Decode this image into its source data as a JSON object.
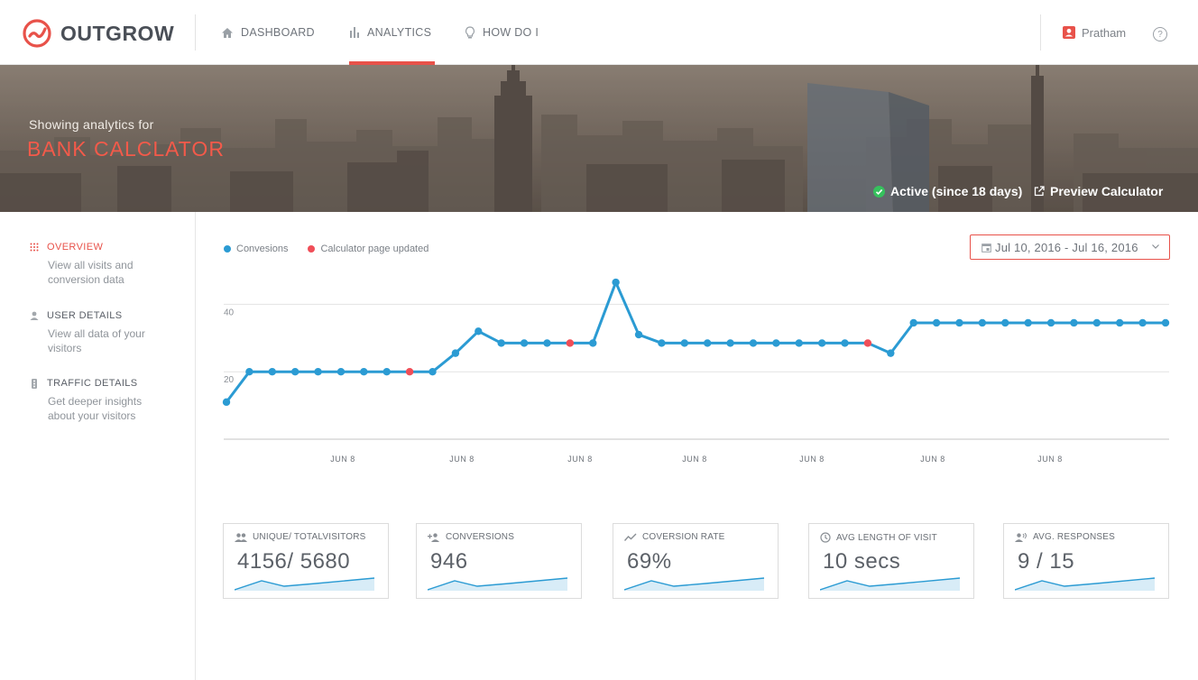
{
  "app": {
    "brand": "OUTGROW",
    "accent_color": "#e8524a",
    "line_color": "#2b9bd3"
  },
  "nav": {
    "items": [
      {
        "label": "DASHBOARD",
        "icon": "home-icon"
      },
      {
        "label": "ANALYTICS",
        "icon": "bar-chart-icon",
        "active": true
      },
      {
        "label": "HOW DO I",
        "icon": "lightbulb-icon"
      }
    ],
    "user_name": "Pratham",
    "help_glyph": "?"
  },
  "hero": {
    "subtitle": "Showing analytics for",
    "title": "BANK CALCLATOR",
    "status": "Active (since 18 days)",
    "preview_label": "Preview Calculator"
  },
  "sidebar": {
    "items": [
      {
        "title": "OVERVIEW",
        "desc_line1": "View all visits and",
        "desc_line2": "conversion data",
        "icon": "grid-dots-icon",
        "active": true
      },
      {
        "title": "USER DETAILS",
        "desc_line1": "View all data of your",
        "desc_line2": "visitors",
        "icon": "person-icon"
      },
      {
        "title": "TRAFFIC DETAILS",
        "desc_line1": "Get deeper insights",
        "desc_line2": "about your visitors",
        "icon": "traffic-light-icon"
      }
    ]
  },
  "filters": {
    "date_range": "Jul 10, 2016 - Jul 16, 2016"
  },
  "chart_data": {
    "type": "line",
    "legend": [
      {
        "name": "Convesions",
        "color": "#2b9bd3"
      },
      {
        "name": "Calculator page updated",
        "color": "#f04e58"
      }
    ],
    "ylim": [
      0,
      50
    ],
    "yticks": [
      20,
      40
    ],
    "xtick_labels": [
      "JUN 8",
      "JUN 8",
      "JUN 8",
      "JUN 8",
      "JUN 8",
      "JUN 8",
      "JUN 8"
    ],
    "grid": true,
    "series": [
      {
        "name": "Convesions",
        "values": [
          11,
          20,
          20,
          20,
          20,
          20,
          20,
          20,
          20,
          20,
          25.5,
          32,
          28.5,
          28.5,
          28.5,
          28.5,
          28.5,
          46.5,
          31,
          28.5,
          28.5,
          28.5,
          28.5,
          28.5,
          28.5,
          28.5,
          28.5,
          28.5,
          28.5,
          25.5,
          34.5,
          34.5,
          34.5,
          34.5,
          34.5,
          34.5,
          34.5,
          34.5,
          34.5,
          34.5,
          34.5,
          34.5
        ]
      }
    ],
    "highlight_indices": [
      8,
      15,
      28
    ]
  },
  "cards": [
    {
      "label": "UNIQUE/ TOTALVISITORS",
      "value": "4156/ 5680",
      "icon": "people-icon"
    },
    {
      "label": "CONVERSIONS",
      "value": "946",
      "icon": "person-add-icon"
    },
    {
      "label": "COVERSION RATE",
      "value": "69%",
      "icon": "trend-icon"
    },
    {
      "label": "AVG LENGTH OF VISIT",
      "value": "10 secs",
      "icon": "clock-icon"
    },
    {
      "label": "AVG. RESPONSES",
      "value": "9 / 15",
      "icon": "voice-icon"
    }
  ]
}
